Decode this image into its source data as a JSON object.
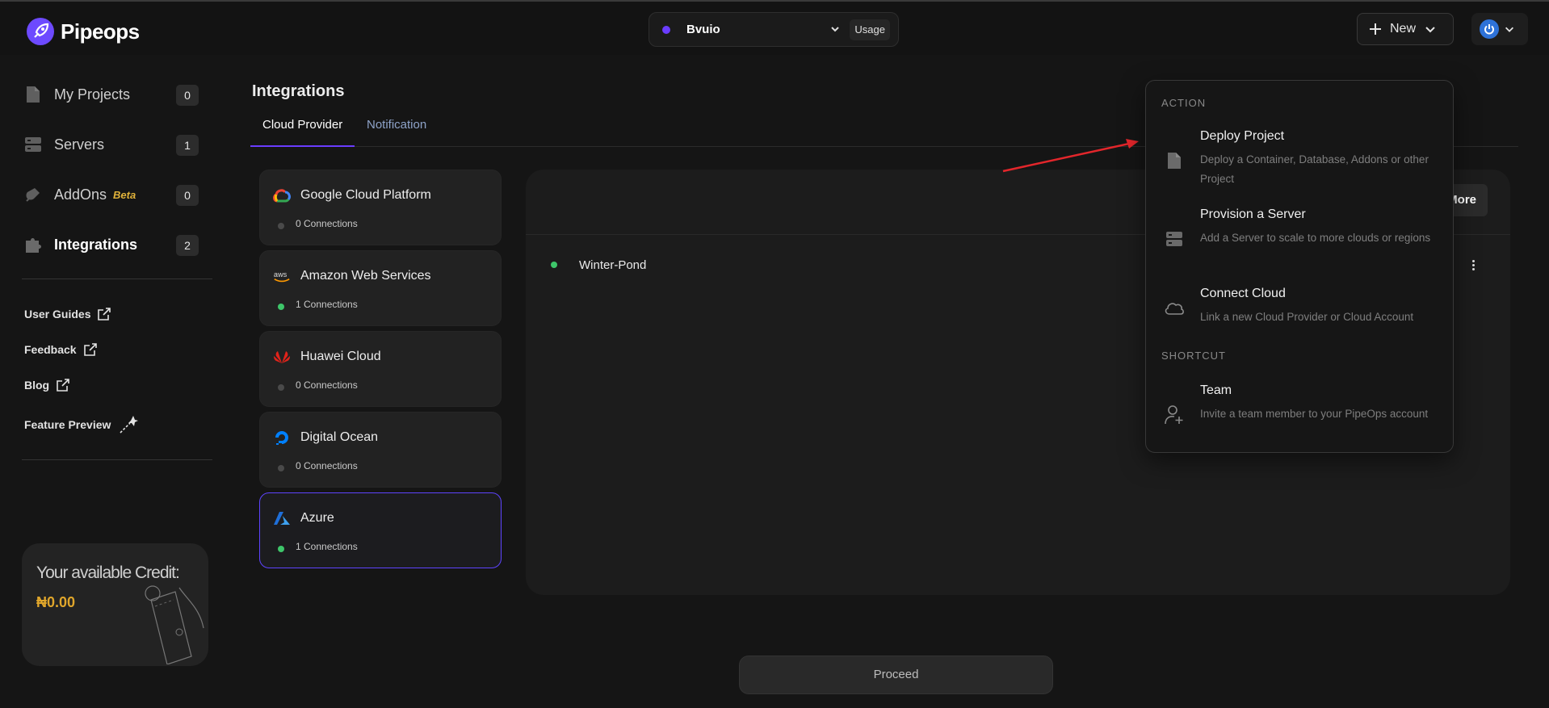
{
  "app": {
    "name": "Pipeops"
  },
  "workspace": {
    "name": "Bvuio",
    "usage_label": "Usage"
  },
  "header": {
    "new_label": "New"
  },
  "sidebar": {
    "items": [
      {
        "label": "My Projects",
        "count": "0"
      },
      {
        "label": "Servers",
        "count": "1"
      },
      {
        "label": "AddOns",
        "badge": "Beta",
        "count": "0"
      },
      {
        "label": "Integrations",
        "count": "2"
      }
    ],
    "links": [
      "User Guides",
      "Feedback",
      "Blog",
      "Feature Preview"
    ],
    "credit": {
      "title": "Your available Credit:",
      "amount": "₦0.00"
    }
  },
  "page": {
    "title": "Integrations",
    "tabs": [
      "Cloud Provider",
      "Notification"
    ]
  },
  "providers": [
    {
      "name": "Google Cloud Platform",
      "connections": "0 Connections",
      "connected": false
    },
    {
      "name": "Amazon Web Services",
      "connections": "1 Connections",
      "connected": true
    },
    {
      "name": "Huawei Cloud",
      "connections": "0 Connections",
      "connected": false
    },
    {
      "name": "Digital Ocean",
      "connections": "0 Connections",
      "connected": false
    },
    {
      "name": "Azure",
      "connections": "1 Connections",
      "connected": true
    }
  ],
  "panel": {
    "more_label": "More",
    "rows": [
      {
        "name": "Winter-Pond",
        "status_color": "#3ec66a"
      }
    ]
  },
  "proceed_label": "Proceed",
  "new_menu": {
    "action_label": "ACTION",
    "shortcut_label": "SHORTCUT",
    "actions": [
      {
        "title": "Deploy Project",
        "description": "Deploy a Container, Database, Addons or other Project",
        "icon": "file-icon"
      },
      {
        "title": "Provision a Server",
        "description": "Add a Server to scale to more clouds or regions",
        "icon": "server-icon"
      },
      {
        "title": "Connect Cloud",
        "description": "Link a new Cloud Provider or Cloud Account",
        "icon": "cloud-icon"
      }
    ],
    "shortcuts": [
      {
        "title": "Team",
        "description": "Invite a team member to your PipeOps account",
        "icon": "user-plus-icon"
      }
    ]
  },
  "colors": {
    "accent": "#6a3cff",
    "connected": "#3ec66a",
    "credit": "#e0a62b",
    "beta": "#e0b23a"
  }
}
